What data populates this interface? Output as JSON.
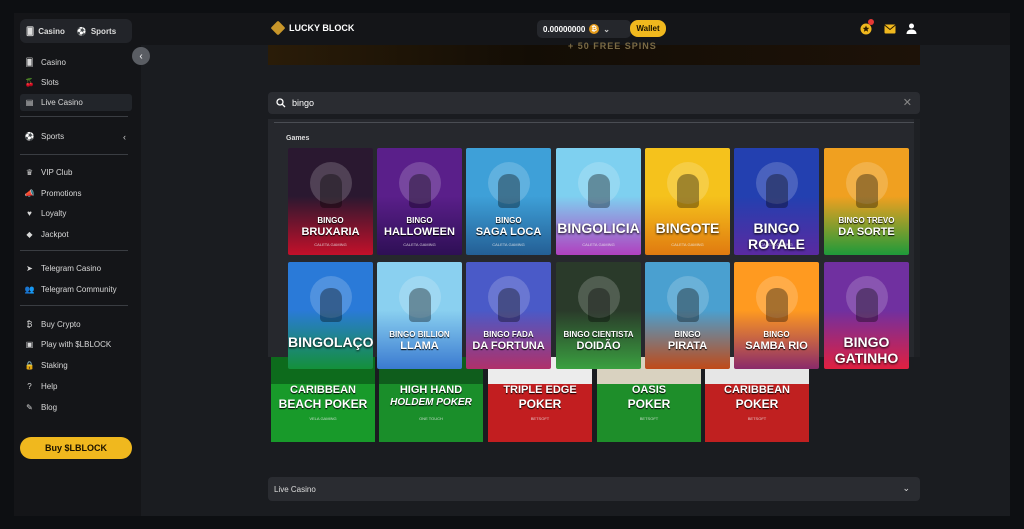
{
  "sidebar": {
    "switch": {
      "casino": "Casino",
      "sports": "Sports"
    },
    "items": [
      {
        "label": "Casino",
        "icon": "casino-icon"
      },
      {
        "label": "Slots",
        "icon": "slots-icon"
      },
      {
        "label": "Live Casino",
        "icon": "live-casino-icon"
      },
      {
        "label": "Sports",
        "icon": "sports-icon"
      },
      {
        "label": "VIP Club",
        "icon": "crown-icon"
      },
      {
        "label": "Promotions",
        "icon": "megaphone-icon"
      },
      {
        "label": "Loyalty",
        "icon": "hand-heart-icon"
      },
      {
        "label": "Jackpot",
        "icon": "diamond-icon"
      },
      {
        "label": "Telegram Casino",
        "icon": "telegram-icon"
      },
      {
        "label": "Telegram Community",
        "icon": "community-icon"
      },
      {
        "label": "Buy Crypto",
        "icon": "bitcoin-icon"
      },
      {
        "label": "Play with $LBLOCK",
        "icon": "wallet-icon"
      },
      {
        "label": "Staking",
        "icon": "lock-icon"
      },
      {
        "label": "Help",
        "icon": "help-icon"
      },
      {
        "label": "Blog",
        "icon": "edit-icon"
      }
    ],
    "buy_label": "Buy $LBLOCK"
  },
  "header": {
    "logo_text": "LUCKY BLOCK",
    "balance": "0.00000000",
    "coin_symbol": "₿",
    "wallet_label": "Wallet"
  },
  "banner": {
    "text": "+ 50 FREE SPINS"
  },
  "search": {
    "value": "bingo",
    "placeholder": ""
  },
  "results": {
    "section_title": "Games",
    "games": [
      {
        "line1": "BINGO",
        "line2": "BRUXARIA",
        "studio": "CALETA GAMING",
        "colors": [
          "#2a1830",
          "#c4102a"
        ]
      },
      {
        "line1": "BINGO",
        "line2": "HALLOWEEN",
        "studio": "CALETA GAMING",
        "colors": [
          "#5a1f8a",
          "#2e0f55"
        ]
      },
      {
        "line1": "BINGO",
        "line2": "SAGA LOCA",
        "studio": "CALETA GAMING",
        "colors": [
          "#3ea0d8",
          "#245f95"
        ]
      },
      {
        "line1": "",
        "line2": "BINGOLICIA",
        "studio": "CALETA GAMING",
        "colors": [
          "#7ed0f0",
          "#b040c0"
        ]
      },
      {
        "line1": "",
        "line2": "BINGOTE",
        "studio": "CALETA GAMING",
        "colors": [
          "#f5c21c",
          "#e07a10"
        ]
      },
      {
        "line1": "",
        "line2": "BINGO ROYALE",
        "studio": "CALETA GAMING",
        "colors": [
          "#2340b0",
          "#5a2aa0"
        ]
      },
      {
        "line1": "BINGO TREVO",
        "line2": "DA SORTE",
        "studio": "",
        "colors": [
          "#f0a020",
          "#1e9a3a"
        ]
      },
      {
        "line1": "",
        "line2": "BINGOLAÇO",
        "studio": "",
        "colors": [
          "#2a7ad8",
          "#14903a"
        ]
      },
      {
        "line1": "BINGO BILLION",
        "line2": "LLAMA",
        "studio": "",
        "colors": [
          "#8ad0f0",
          "#3a7ad0"
        ]
      },
      {
        "line1": "BINGO FADA",
        "line2": "DA FORTUNA",
        "studio": "",
        "colors": [
          "#4a5ac8",
          "#b0306a"
        ]
      },
      {
        "line1": "BINGO CIENTISTA",
        "line2": "DOIDÃO",
        "studio": "",
        "colors": [
          "#2a3a2a",
          "#3aa040"
        ]
      },
      {
        "line1": "BINGO",
        "line2": "PIRATA",
        "studio": "",
        "colors": [
          "#4aa0d0",
          "#c04a18"
        ]
      },
      {
        "line1": "BINGO",
        "line2": "SAMBA RIO",
        "studio": "",
        "colors": [
          "#ff9a20",
          "#8a2a6a"
        ]
      },
      {
        "line1": "",
        "line2": "BINGO GATINHO",
        "studio": "",
        "colors": [
          "#7030a0",
          "#e02040"
        ]
      }
    ]
  },
  "poker_games": [
    {
      "line1": "CARIBBEAN",
      "line2": "BEACH POKER",
      "studio": "VELA GAMING",
      "color": "#189a2a",
      "top": "#0d6b1c",
      "italic": false
    },
    {
      "line1": "HIGH HAND",
      "line2": "HOLDEM POKER",
      "studio": "ONE TOUCH",
      "color": "#1a8e2a",
      "top": "#0f5d1c",
      "italic": true
    },
    {
      "line1": "TRIPLE EDGE",
      "line2": "POKER",
      "studio": "BETSOFT",
      "color": "#c21e20",
      "top": "#ececec",
      "italic": false
    },
    {
      "line1": "OASIS",
      "line2": "POKER",
      "studio": "BETSOFT",
      "color": "#1e8e2a",
      "top": "#d9d2c0",
      "italic": false
    },
    {
      "line1": "CARIBBEAN",
      "line2": "POKER",
      "studio": "BETSOFT",
      "color": "#c02020",
      "top": "#e6e6e6",
      "italic": false
    }
  ],
  "live_section": {
    "label": "Live Casino"
  }
}
